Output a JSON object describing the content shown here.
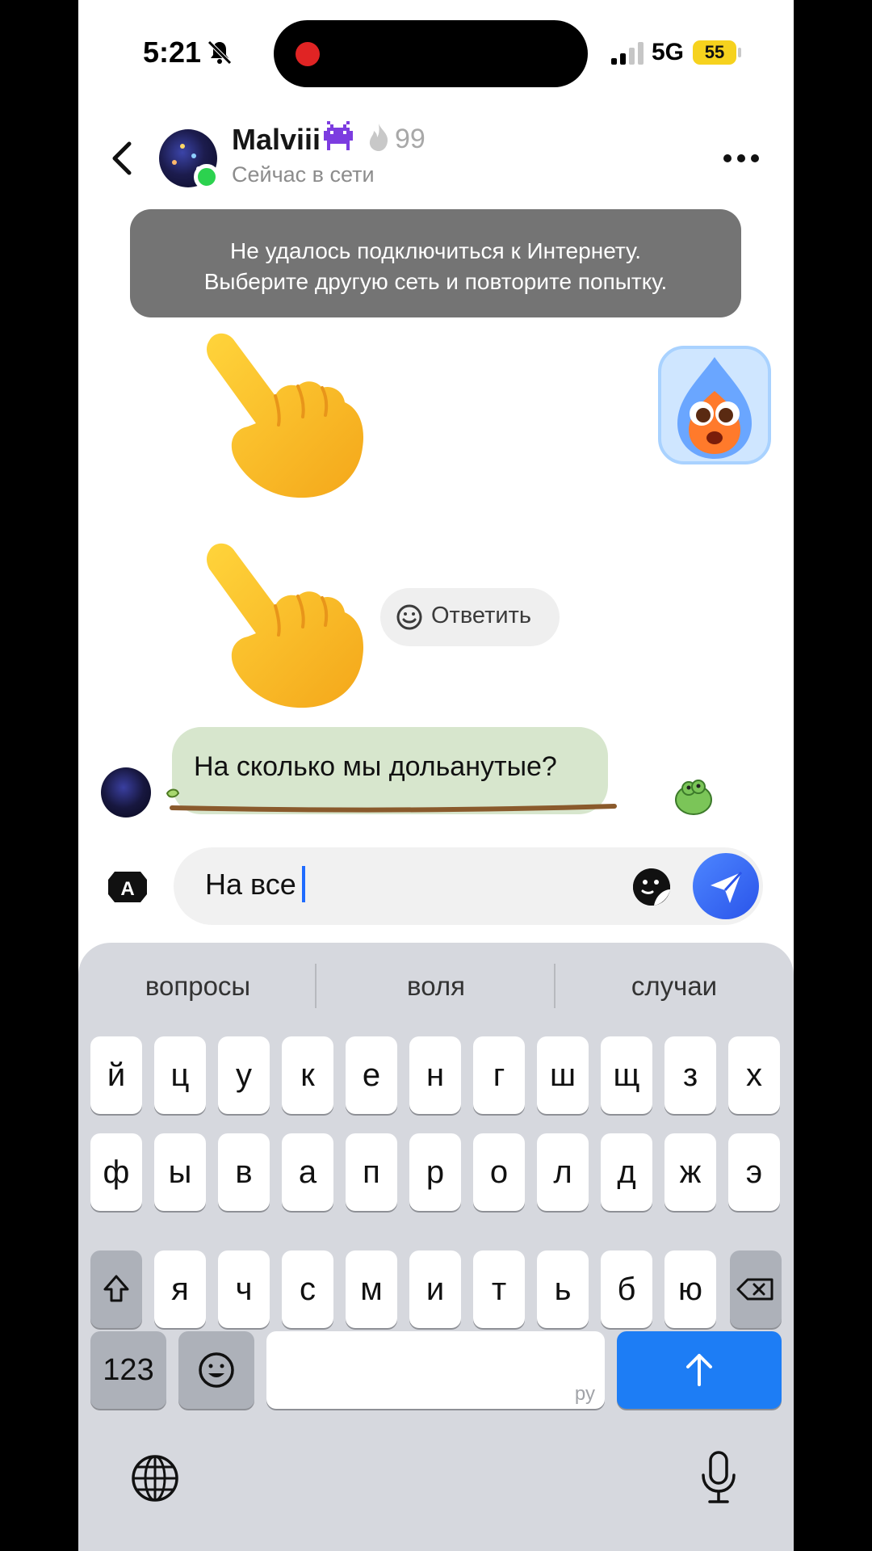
{
  "status_bar": {
    "time": "5:21",
    "network": "5G",
    "battery": "55"
  },
  "header": {
    "contact_name": "Malviii",
    "streak": "99",
    "status": "Сейчас в сети"
  },
  "toast": {
    "line1": "Не удалось подключиться к Интернету.",
    "line2": "Выберите другую сеть и повторите попытку."
  },
  "reply_chip": {
    "label": "Ответить"
  },
  "message": {
    "text": "На сколько мы дольанутые?"
  },
  "composer": {
    "value": "На все"
  },
  "keyboard": {
    "suggestions": [
      "вопросы",
      "воля",
      "случаи"
    ],
    "row1": [
      "й",
      "ц",
      "у",
      "к",
      "е",
      "н",
      "г",
      "ш",
      "щ",
      "з",
      "х"
    ],
    "row2": [
      "ф",
      "ы",
      "в",
      "а",
      "п",
      "р",
      "о",
      "л",
      "д",
      "ж",
      "э"
    ],
    "row3": [
      "я",
      "ч",
      "с",
      "м",
      "и",
      "т",
      "ь",
      "б",
      "ю"
    ],
    "numbers_label": "123",
    "space_hint": "ру"
  },
  "colors": {
    "accent": "#1d7df5",
    "online": "#2cd24f",
    "bubble": "#d7e6cd",
    "battery": "#f6d21e"
  },
  "icons": [
    "bell-muted-icon",
    "signal-icon",
    "back-icon",
    "alien-icon",
    "flame-icon",
    "more-icon",
    "smile-icon",
    "keyboard-switch-icon",
    "sticker-icon",
    "send-icon",
    "shift-icon",
    "backspace-icon",
    "emoji-icon",
    "return-icon",
    "globe-icon",
    "microphone-icon"
  ]
}
